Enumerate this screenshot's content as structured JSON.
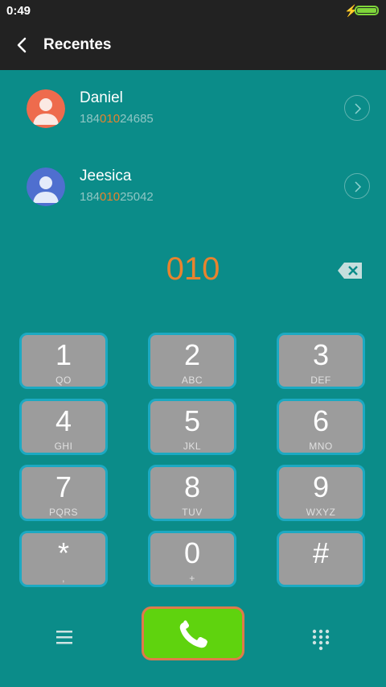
{
  "status_bar": {
    "time": "0:49",
    "battery_level": 1.0
  },
  "app_bar": {
    "title": "Recentes",
    "back_icon": "arrow-back-icon"
  },
  "contacts": [
    {
      "name": "Daniel",
      "number_pre": "184",
      "number_match": "010",
      "number_post": "24685",
      "avatar_color": "#ee6b4d"
    },
    {
      "name": "Jeesica",
      "number_pre": "184",
      "number_match": "010",
      "number_post": "25042",
      "avatar_color": "#4f6fcf"
    }
  ],
  "dialer": {
    "number": "010"
  },
  "keys": [
    {
      "digit": "1",
      "letters": "QO"
    },
    {
      "digit": "2",
      "letters": "ABC"
    },
    {
      "digit": "3",
      "letters": "DEF"
    },
    {
      "digit": "4",
      "letters": "GHI"
    },
    {
      "digit": "5",
      "letters": "JKL"
    },
    {
      "digit": "6",
      "letters": "MNO"
    },
    {
      "digit": "7",
      "letters": "PQRS"
    },
    {
      "digit": "8",
      "letters": "TUV"
    },
    {
      "digit": "9",
      "letters": "WXYZ"
    },
    {
      "digit": "*",
      "letters": ","
    },
    {
      "digit": "0",
      "letters": "+"
    },
    {
      "digit": "#",
      "letters": ""
    }
  ],
  "colors": {
    "background": "#0b8c89",
    "highlight": "#e8832e",
    "call_button": "#5fd30e",
    "key": "#9c9c9c",
    "key_border": "#1ca9c2"
  }
}
